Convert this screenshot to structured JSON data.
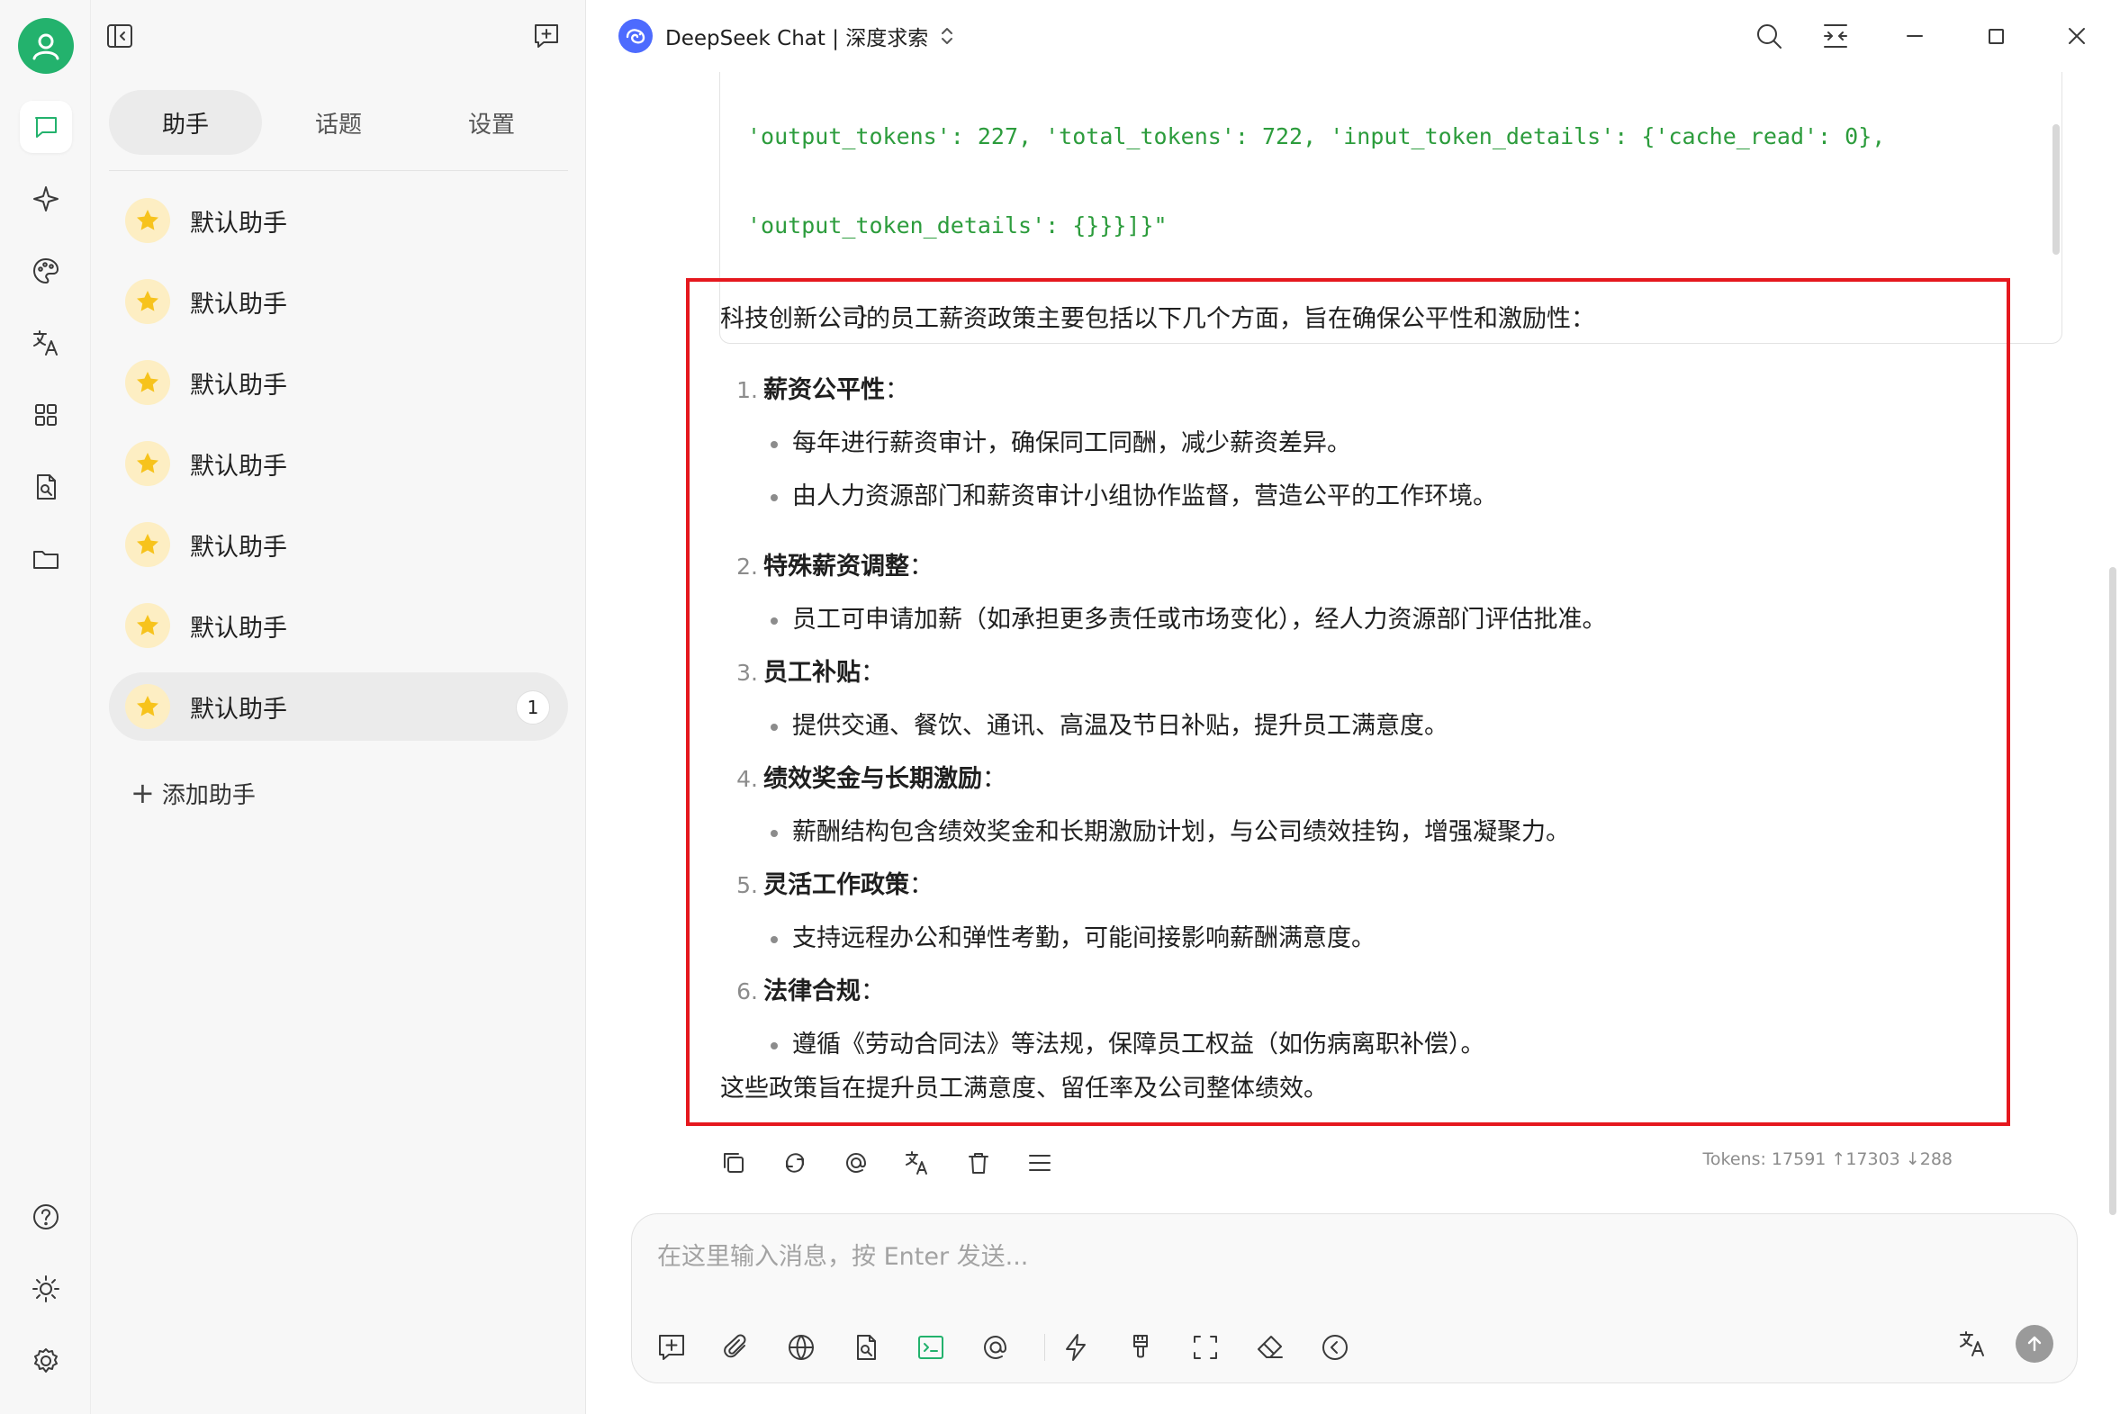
{
  "window": {
    "model_title": "DeepSeek Chat | 深度求索"
  },
  "rail": {
    "items": [
      "chat-icon",
      "sparkle-icon",
      "palette-icon",
      "translate-icon",
      "apps-icon",
      "document-search-icon",
      "folder-icon"
    ],
    "bottom_items": [
      "help-icon",
      "brightness-icon",
      "settings-gear-icon"
    ],
    "accent": "#23b26d"
  },
  "panel": {
    "tabs": [
      {
        "label": "助手",
        "active": true
      },
      {
        "label": "话题",
        "active": false
      },
      {
        "label": "设置",
        "active": false
      }
    ],
    "assistants": [
      {
        "name": "默认助手"
      },
      {
        "name": "默认助手"
      },
      {
        "name": "默认助手"
      },
      {
        "name": "默认助手"
      },
      {
        "name": "默认助手"
      },
      {
        "name": "默认助手"
      },
      {
        "name": "默认助手",
        "selected": true,
        "count": "1"
      }
    ],
    "add_label": "添加助手"
  },
  "code_block": {
    "lines": [
      "'output_tokens': 227, 'total_tokens': 722, 'input_token_details': {'cache_read': 0},",
      "'output_token_details': {}}}]}\"",
      "        }",
      "      ]",
      "    }",
      "  }"
    ]
  },
  "answer": {
    "intro": "科技创新公司的员工薪资政策主要包括以下几个方面，旨在确保公平性和激励性：",
    "sections": [
      {
        "num": "1.",
        "title": "薪资公平性",
        "colon": "：",
        "bullets": [
          "每年进行薪资审计，确保同工同酬，减少薪资差异。",
          "由人力资源部门和薪资审计小组协作监督，营造公平的工作环境。"
        ]
      },
      {
        "num": "2.",
        "title": "特殊薪资调整",
        "colon": "：",
        "bullets": [
          "员工可申请加薪（如承担更多责任或市场变化），经人力资源部门评估批准。"
        ]
      },
      {
        "num": "3.",
        "title": "员工补贴",
        "colon": "：",
        "bullets": [
          "提供交通、餐饮、通讯、高温及节日补贴，提升员工满意度。"
        ]
      },
      {
        "num": "4.",
        "title": "绩效奖金与长期激励",
        "colon": "：",
        "bullets": [
          "薪酬结构包含绩效奖金和长期激励计划，与公司绩效挂钩，增强凝聚力。"
        ]
      },
      {
        "num": "5.",
        "title": "灵活工作政策",
        "colon": "：",
        "bullets": [
          "支持远程办公和弹性考勤，可能间接影响薪酬满意度。"
        ]
      },
      {
        "num": "6.",
        "title": "法律合规",
        "colon": "：",
        "bullets": [
          "遵循《劳动合同法》等法规，保障员工权益（如伤病离职补偿）。"
        ]
      }
    ],
    "outro": "这些政策旨在提升员工满意度、留任率及公司整体绩效。",
    "highlight_color": "#e5181e"
  },
  "message_actions": [
    "copy-icon",
    "regenerate-icon",
    "mention-icon",
    "translate-icon",
    "delete-icon",
    "menu-icon"
  ],
  "tokens": "Tokens: 17591 ↑17303 ↓288",
  "composer": {
    "placeholder": "在这里输入消息，按 Enter 发送...",
    "tools": [
      "new-topic-icon",
      "attachment-icon",
      "web-search-icon",
      "knowledge-icon",
      "code-icon",
      "mention-icon",
      "quick-phrase-icon",
      "clear-style-icon",
      "fullscreen-icon",
      "eraser-icon",
      "collapse-icon",
      "translate-icon",
      "send-icon"
    ]
  }
}
